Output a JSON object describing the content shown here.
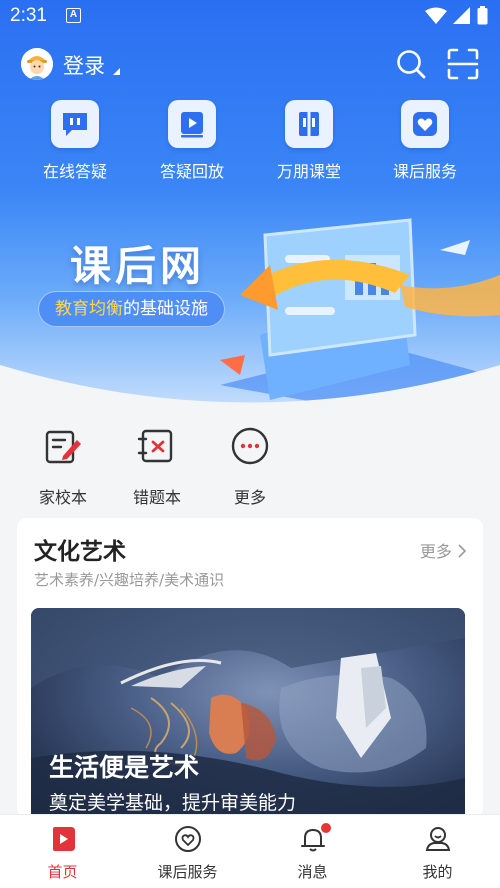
{
  "status_bar": {
    "time": "2:31",
    "notification_letter": "A"
  },
  "header": {
    "login_label": "登录"
  },
  "features": [
    {
      "label": "在线答疑",
      "icon": "chat-icon"
    },
    {
      "label": "答疑回放",
      "icon": "play-icon"
    },
    {
      "label": "万朋课堂",
      "icon": "book-icon"
    },
    {
      "label": "课后服务",
      "icon": "heart-icon"
    }
  ],
  "banner": {
    "title": "课后网",
    "subtitle_highlight": "教育均衡",
    "subtitle_rest": "的基础设施"
  },
  "tools": [
    {
      "label": "家校本",
      "icon": "edit-note-icon"
    },
    {
      "label": "错题本",
      "icon": "wrong-questions-icon"
    },
    {
      "label": "更多",
      "icon": "more-icon"
    }
  ],
  "culture_section": {
    "title": "文化艺术",
    "more_label": "更多",
    "subtitle": "艺术素养/兴趣培养/美术通识",
    "image_title": "生活便是艺术",
    "image_subtitle": "奠定美学基础，提升审美能力"
  },
  "bottom_nav": [
    {
      "label": "首页",
      "active": true
    },
    {
      "label": "课后服务",
      "active": false
    },
    {
      "label": "消息",
      "active": false,
      "badge": true
    },
    {
      "label": "我的",
      "active": false
    }
  ],
  "colors": {
    "primary_blue": "#2a6ff2",
    "active_red": "#e0343a",
    "highlight_yellow": "#ffd84a"
  }
}
